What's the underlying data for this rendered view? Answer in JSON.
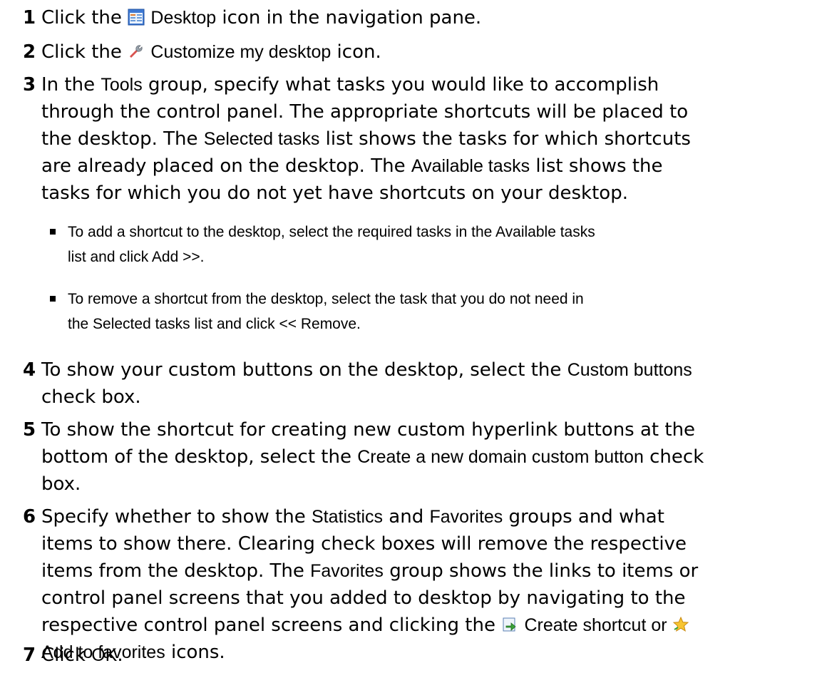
{
  "steps": [
    {
      "num": "1",
      "a": "Click the ",
      "ui1": "Desktop",
      "b": " icon in the navigation pane."
    },
    {
      "num": "2",
      "a": "Click the ",
      "ui1": "Customize my desktop",
      "b": " icon."
    },
    {
      "num": "3",
      "l1a": "In the ",
      "l1ui": "Tools",
      "l1b": " group, specify what tasks you would like to accomplish",
      "l2": "through the control panel. The appropriate shortcuts will be placed to",
      "l3a": "the desktop. The ",
      "l3ui": "Selected tasks",
      "l3b": " list shows the tasks for which shortcuts",
      "l4a": "are already placed on the desktop. The ",
      "l4ui": "Available tasks",
      "l4b": " list shows the",
      "l5": "tasks for which you do not yet have shortcuts on your desktop."
    },
    {
      "num": "4",
      "l1a": "To show your custom buttons on the desktop, select the ",
      "l1ui": "Custom buttons",
      "l2": "check box."
    },
    {
      "num": "5",
      "l1": "To show the shortcut for creating new custom hyperlink buttons at the",
      "l2a": "bottom of the desktop, select the ",
      "l2ui": "Create a new domain custom button",
      "l2b": " check",
      "l3": "box."
    },
    {
      "num": "6",
      "l1a": "Specify whether to show the ",
      "l1ui1": "Statistics",
      "l1b": " and ",
      "l1ui2": "Favorites",
      "l1c": " groups and what",
      "l2": "items to show there. Clearing check boxes will remove the respective",
      "l3a": "items from the desktop. The ",
      "l3ui": "Favorites",
      "l3b": " group shows the links to items or",
      "l4": "control panel screens that you added to desktop by navigating to the",
      "l5a": "respective control panel screens and clicking the ",
      "l5ui1": "Create shortcut",
      "l5b": " or ",
      "l6ui": "Add to favorites",
      "l6b": " icons."
    },
    {
      "num": "7",
      "a": "Click ",
      "ui1": "OK",
      "b": "."
    }
  ],
  "bullets": [
    {
      "l1a": "To add a shortcut to the desktop, select the required tasks in the ",
      "l1ui": "Available tasks",
      "l2a": "list and click ",
      "l2ui": "Add >>",
      "l2b": "."
    },
    {
      "l1": "To remove a shortcut from the desktop, select the task that you do not need in",
      "l2a": "the ",
      "l2ui1": "Selected tasks",
      "l2b": " list and click ",
      "l2ui2": "<< Remove",
      "l2c": "."
    }
  ]
}
